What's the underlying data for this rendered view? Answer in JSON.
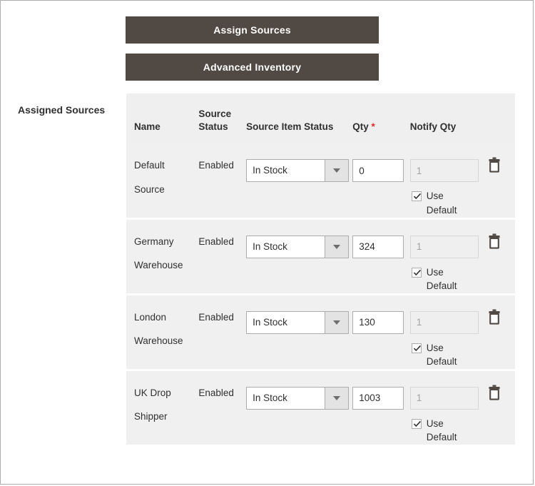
{
  "buttons": {
    "assign_sources": "Assign Sources",
    "advanced_inventory": "Advanced Inventory"
  },
  "section": {
    "label": "Assigned Sources"
  },
  "table": {
    "headers": {
      "name": "Name",
      "source_status_line1": "Source",
      "source_status_line2": "Status",
      "source_item_status": "Source Item Status",
      "qty": "Qty",
      "qty_required_marker": "*",
      "notify_qty": "Notify Qty"
    },
    "use_default_label_line1": "Use",
    "use_default_label_line2": "Default",
    "delete_icon_title": "Delete",
    "rows": [
      {
        "name_line1": "Default",
        "name_line2": "Source",
        "source_status": "Enabled",
        "source_item_status": "In Stock",
        "qty": "0",
        "notify_qty": "1",
        "use_default_checked": "✓"
      },
      {
        "name_line1": "Germany",
        "name_line2": "Warehouse",
        "source_status": "Enabled",
        "source_item_status": "In Stock",
        "qty": "324",
        "notify_qty": "1",
        "use_default_checked": "✓"
      },
      {
        "name_line1": "London",
        "name_line2": "Warehouse",
        "source_status": "Enabled",
        "source_item_status": "In Stock",
        "qty": "130",
        "notify_qty": "1",
        "use_default_checked": "✓"
      },
      {
        "name_line1": "UK Drop",
        "name_line2": "Shipper",
        "source_status": "Enabled",
        "source_item_status": "In Stock",
        "qty": "1003",
        "notify_qty": "1",
        "use_default_checked": "✓"
      }
    ]
  },
  "colors": {
    "button_bg": "#514943",
    "button_text": "#ffffff",
    "row_bg": "#f0f0f0",
    "header_bg": "#efefef",
    "text": "#303030",
    "required_star": "#e02b27",
    "border": "#adadad",
    "disabled_text": "#a3a3a3"
  }
}
